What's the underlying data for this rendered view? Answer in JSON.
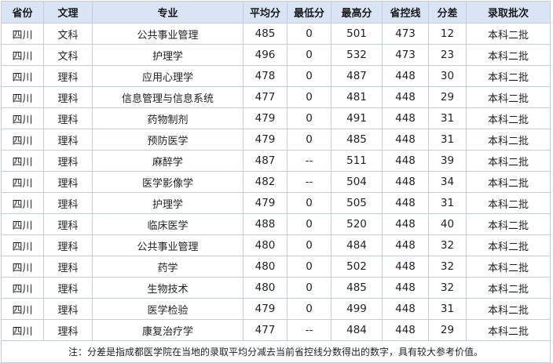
{
  "table": {
    "headers": [
      "省份",
      "文理",
      "专业",
      "平均分",
      "最低分",
      "最高分",
      "省控线",
      "分差",
      "录取批次"
    ],
    "rows": [
      [
        "四川",
        "文科",
        "公共事业管理",
        "485",
        "0",
        "501",
        "473",
        "12",
        "本科二批"
      ],
      [
        "四川",
        "文科",
        "护理学",
        "496",
        "0",
        "532",
        "473",
        "23",
        "本科二批"
      ],
      [
        "四川",
        "理科",
        "应用心理学",
        "478",
        "0",
        "487",
        "448",
        "30",
        "本科二批"
      ],
      [
        "四川",
        "理科",
        "信息管理与信息系统",
        "477",
        "0",
        "481",
        "448",
        "29",
        "本科二批"
      ],
      [
        "四川",
        "理科",
        "药物制剂",
        "479",
        "0",
        "491",
        "448",
        "31",
        "本科二批"
      ],
      [
        "四川",
        "理科",
        "预防医学",
        "479",
        "0",
        "485",
        "448",
        "31",
        "本科二批"
      ],
      [
        "四川",
        "理科",
        "麻醉学",
        "487",
        "--",
        "511",
        "448",
        "39",
        "本科二批"
      ],
      [
        "四川",
        "理科",
        "医学影像学",
        "482",
        "--",
        "504",
        "448",
        "34",
        "本科二批"
      ],
      [
        "四川",
        "理科",
        "护理学",
        "479",
        "0",
        "505",
        "448",
        "31",
        "本科二批"
      ],
      [
        "四川",
        "理科",
        "临床医学",
        "488",
        "0",
        "520",
        "448",
        "40",
        "本科二批"
      ],
      [
        "四川",
        "理科",
        "公共事业管理",
        "480",
        "0",
        "484",
        "448",
        "32",
        "本科二批"
      ],
      [
        "四川",
        "理科",
        "药学",
        "480",
        "0",
        "502",
        "448",
        "32",
        "本科二批"
      ],
      [
        "四川",
        "理科",
        "生物技术",
        "480",
        "0",
        "485",
        "448",
        "32",
        "本科二批"
      ],
      [
        "四川",
        "理科",
        "医学检验",
        "479",
        "0",
        "499",
        "448",
        "31",
        "本科二批"
      ],
      [
        "四川",
        "理科",
        "康复治疗学",
        "477",
        "--",
        "484",
        "448",
        "29",
        "本科二批"
      ]
    ],
    "note": "注：分差是指成都医学院在当地的录取平均分减去当前省控线分数得出的数字，具有较大参考价值。",
    "colors": {
      "header_bg": "#d9e5f5",
      "border": "#c5ccd8",
      "text": "#1f1f1f"
    }
  }
}
